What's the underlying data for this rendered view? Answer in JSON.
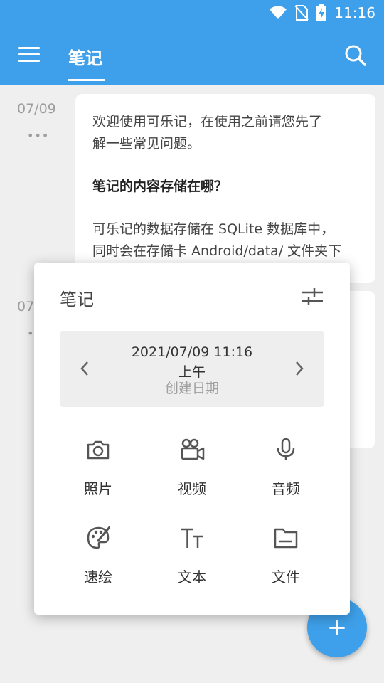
{
  "status_bar": {
    "time": "11:16"
  },
  "app_bar": {
    "title": "笔记"
  },
  "notes": [
    {
      "date": "07/09",
      "paragraphs": [
        "欢迎使用可乐记，在使用之前请您先了",
        "解一些常见问题。",
        "笔记的内容存储在哪？",
        "可乐记的数据存储在 SQLite 数据库中，",
        "同时会在存储卡 Android/data/ 文件夹下"
      ]
    },
    {
      "date": "07/"
    }
  ],
  "popup": {
    "title": "笔记",
    "datetime": "2021/07/09 11:16",
    "ampm": "上午",
    "date_caption": "创建日期",
    "actions": [
      {
        "label": "照片",
        "icon": "camera-icon"
      },
      {
        "label": "视频",
        "icon": "video-camera-icon"
      },
      {
        "label": "音频",
        "icon": "microphone-icon"
      },
      {
        "label": "速绘",
        "icon": "palette-icon"
      },
      {
        "label": "文本",
        "icon": "text-icon"
      },
      {
        "label": "文件",
        "icon": "folder-icon"
      }
    ]
  },
  "fab": {
    "label": "+"
  },
  "colors": {
    "accent": "#3ea0ea",
    "background": "#efefef"
  }
}
